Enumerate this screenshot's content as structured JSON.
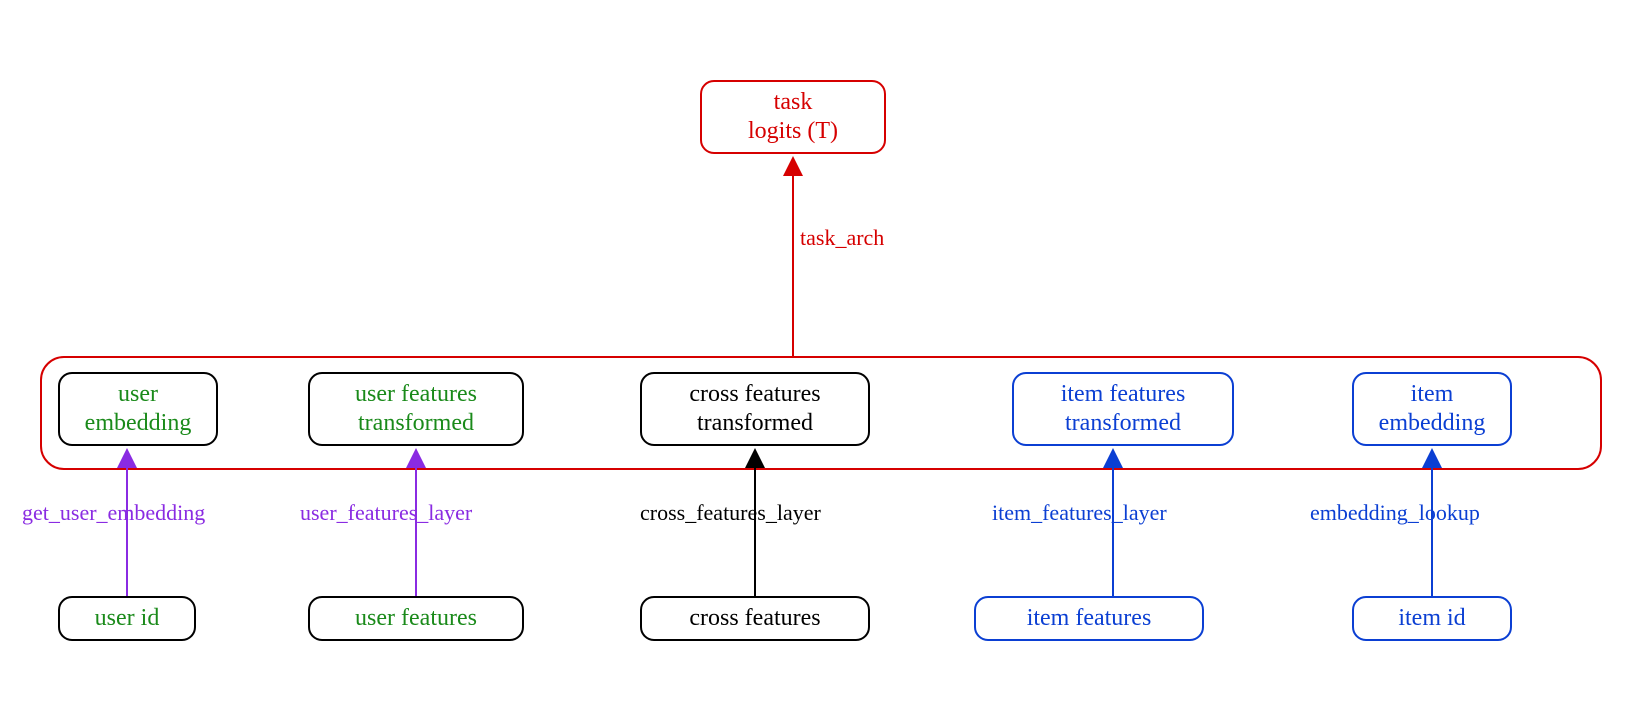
{
  "colors": {
    "green": "#1a8a1a",
    "blue": "#0b3fd3",
    "black": "#000000",
    "red": "#d60000",
    "purple": "#8a2be2"
  },
  "top": {
    "task_logits": [
      "task",
      "logits (T)"
    ]
  },
  "edges": {
    "task_arch": "task_arch",
    "get_user_embedding": "get_user_embedding",
    "user_features_layer": "user_features_layer",
    "cross_features_layer": "cross_features_layer",
    "item_features_layer": "item_features_layer",
    "embedding_lookup": "embedding_lookup"
  },
  "middle": {
    "user_embedding": [
      "user",
      "embedding"
    ],
    "user_features_transformed": [
      "user features",
      "transformed"
    ],
    "cross_features_transformed": [
      "cross features",
      "transformed"
    ],
    "item_features_transformed": [
      "item features",
      "transformed"
    ],
    "item_embedding": [
      "item",
      "embedding"
    ]
  },
  "bottom": {
    "user_id": "user id",
    "user_features": "user features",
    "cross_features": "cross features",
    "item_features": "item features",
    "item_id": "item id"
  }
}
